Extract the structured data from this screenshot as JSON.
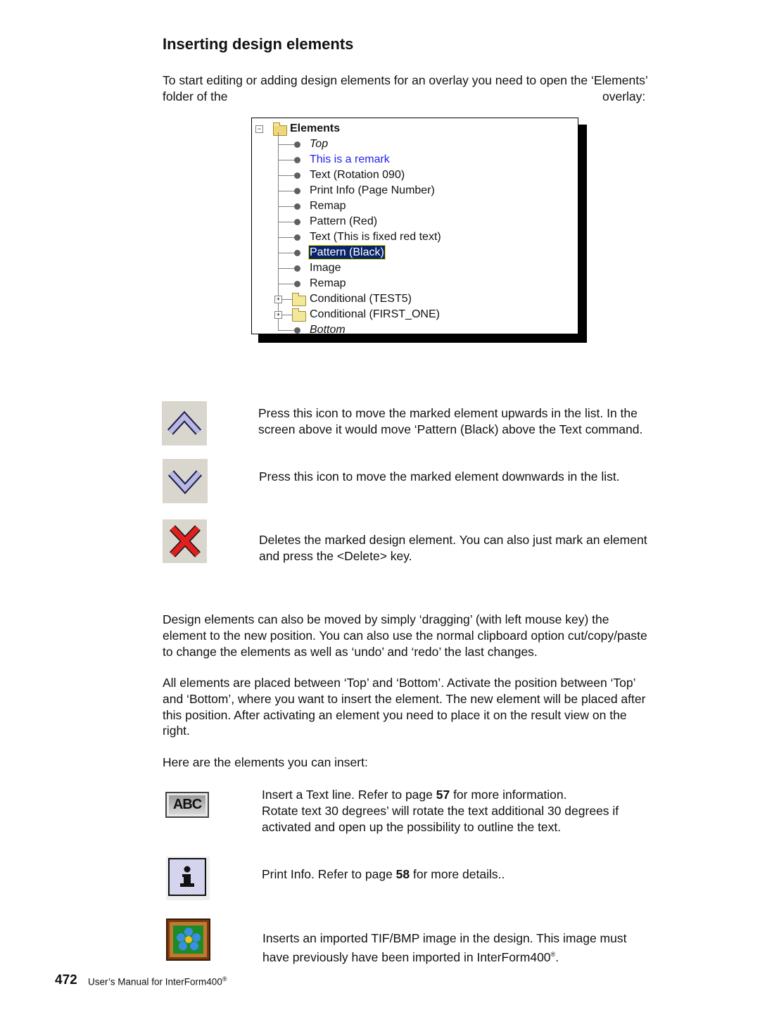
{
  "section": {
    "title": "Inserting design elements",
    "intro_line1": "To start editing or adding design elements for an overlay you need to open the ‘Elements’",
    "intro_line2_left": "folder of the",
    "intro_line2_right": "overlay:"
  },
  "tree": {
    "root_label": "Elements",
    "items": [
      {
        "label": "Top",
        "style": "italic",
        "type": "leaf"
      },
      {
        "label": "This is a remark",
        "style": "remark",
        "type": "leaf"
      },
      {
        "label": "Text (Rotation 090)",
        "style": "normal",
        "type": "leaf"
      },
      {
        "label": "Print Info (Page Number)",
        "style": "normal",
        "type": "leaf"
      },
      {
        "label": "Remap",
        "style": "normal",
        "type": "leaf"
      },
      {
        "label": "Pattern (Red)",
        "style": "normal",
        "type": "leaf"
      },
      {
        "label": "Text (This is fixed red text)",
        "style": "normal",
        "type": "leaf"
      },
      {
        "label": "Pattern (Black)",
        "style": "selected",
        "type": "leaf"
      },
      {
        "label": "Image",
        "style": "normal",
        "type": "leaf"
      },
      {
        "label": "Remap",
        "style": "normal",
        "type": "leaf"
      },
      {
        "label": "Conditional (TEST5)",
        "style": "normal",
        "type": "folder"
      },
      {
        "label": "Conditional (FIRST_ONE)",
        "style": "normal",
        "type": "folder"
      },
      {
        "label": "Bottom",
        "style": "italic",
        "type": "leaf"
      }
    ]
  },
  "buttons": {
    "move_up": {
      "icon": "arrow-up-icon",
      "desc_line1": "Press this icon to move the marked element upwards in the list. In the",
      "desc_line2": "screen above it would move ‘Pattern (Black) above the Text command."
    },
    "move_down": {
      "icon": "arrow-down-icon",
      "desc_line1": "Press this icon to move the marked element downwards in the list."
    },
    "delete": {
      "icon": "delete-x-icon",
      "desc_line1": "Deletes the marked design element. You can also just mark an element",
      "desc_line2": "and press the <Delete> key."
    }
  },
  "paragraphs": {
    "drag": [
      "Design elements can also be moved by simply ‘dragging’ (with left mouse key) the",
      "element to the new position. You can also use the normal clipboard option cut/copy/paste",
      "to change the elements as well as ‘undo’ and ‘redo’ the last changes."
    ],
    "placement": [
      "All elements are placed between ‘Top’ and ‘Bottom’. Activate the position between ‘Top’",
      "and ‘Bottom’, where you want to insert the element. The new element will be placed after",
      "this position. After activating an element you need to place it on the result view on the",
      "right."
    ],
    "insert_intro": "Here are the elements you can insert:"
  },
  "insertables": {
    "text": {
      "icon": "text-abc-icon",
      "icon_text": "ABC",
      "line1_pre": "Insert a Text line. Refer to page ",
      "line1_page": "57",
      "line1_post": " for more information.",
      "line2": "Rotate text 30 degrees’ will rotate the text additional 30 degrees if",
      "line3": "activated and open up the possibility to outline the text."
    },
    "print_info": {
      "icon": "info-icon",
      "line1_pre": "Print Info. Refer to page ",
      "line1_page": "58",
      "line1_post": " for more details.."
    },
    "image": {
      "icon": "image-picture-icon",
      "line1": "Inserts an imported TIF/BMP image in the design. This image must",
      "line2": "have previously have been imported in InterForm400",
      "line2_sup": "®",
      "line2_end": "."
    }
  },
  "footer": {
    "page_number": "472",
    "text": "User’s Manual for InterForm400",
    "sup": "®"
  }
}
